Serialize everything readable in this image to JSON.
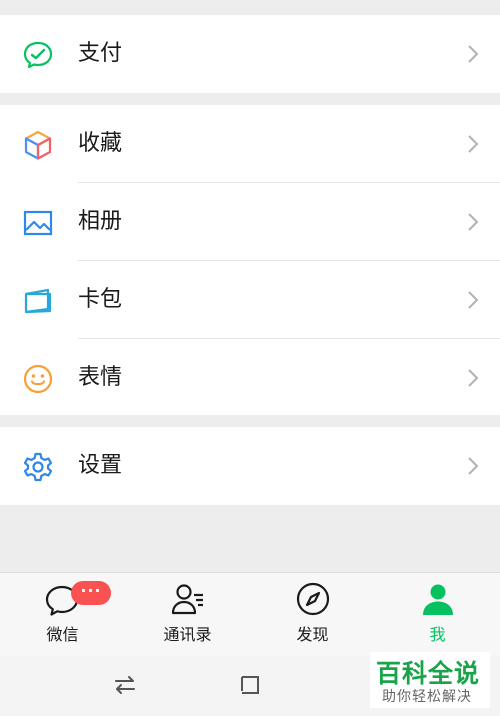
{
  "menu": {
    "pay": {
      "label": "支付",
      "icon": "pay-icon"
    },
    "favorites": {
      "label": "收藏",
      "icon": "cube-icon"
    },
    "album": {
      "label": "相册",
      "icon": "image-icon"
    },
    "cards": {
      "label": "卡包",
      "icon": "card-icon"
    },
    "stickers": {
      "label": "表情",
      "icon": "smiley-icon"
    },
    "settings": {
      "label": "设置",
      "icon": "gear-icon"
    }
  },
  "tabs": [
    {
      "label": "微信",
      "icon": "chat-bubble-icon",
      "badge": "···"
    },
    {
      "label": "通讯录",
      "icon": "contacts-icon"
    },
    {
      "label": "发现",
      "icon": "compass-icon"
    },
    {
      "label": "我",
      "icon": "person-icon",
      "active": true
    }
  ],
  "colors": {
    "accent": "#07c160",
    "badge": "#fa5151",
    "background": "#ededed"
  },
  "watermark": {
    "title": "百科全说",
    "subtitle": "助你轻松解决"
  }
}
